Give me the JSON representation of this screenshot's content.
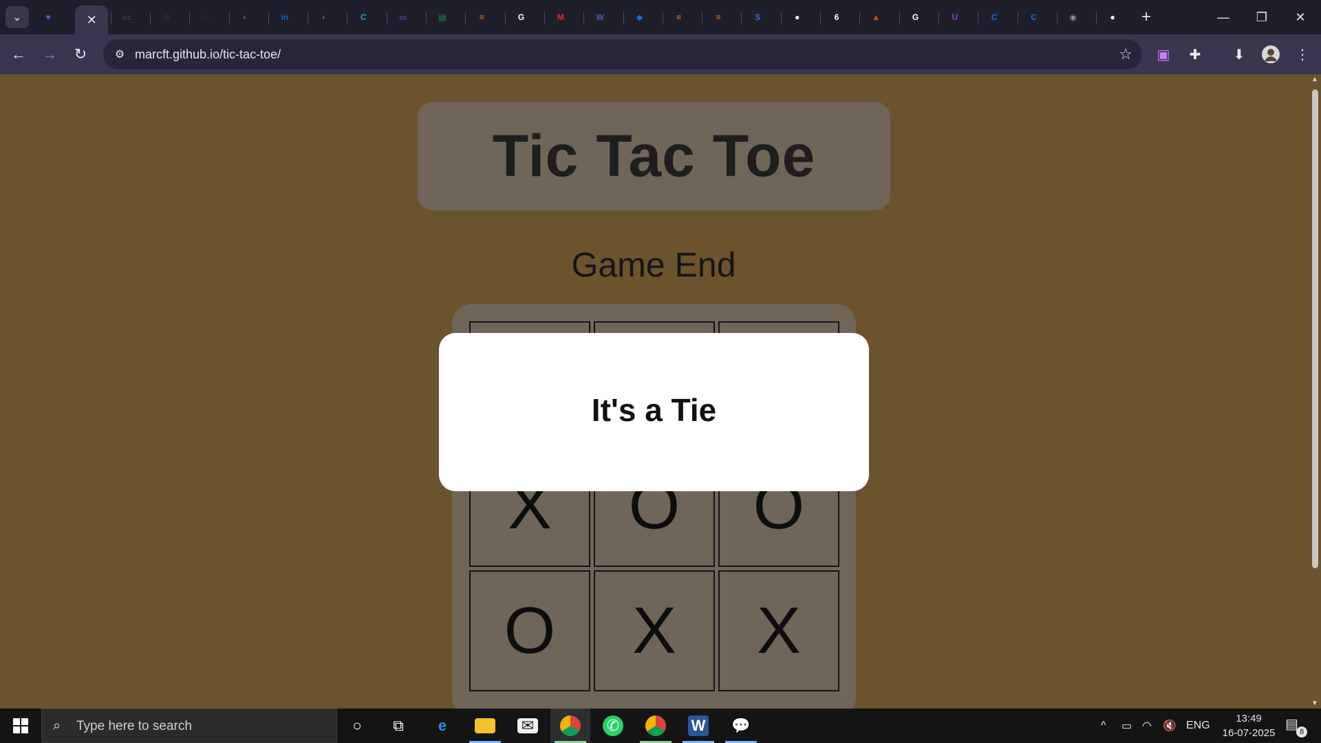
{
  "browser": {
    "url": "marcft.github.io/tic-tac-toe/",
    "tabs": [
      {
        "icon": "shield-heart-icon",
        "glyph": "♥",
        "color": "#3b6fd8"
      },
      {
        "icon": "close-icon",
        "glyph": "✕",
        "active": true
      },
      {
        "icon": "cc-icon",
        "glyph": "cc",
        "color": "#5a3a1a"
      },
      {
        "icon": "target-icon",
        "glyph": "◎",
        "color": "#3a3a3a"
      },
      {
        "icon": "logo-icon",
        "glyph": "≈",
        "color": "#2a2a2a"
      },
      {
        "icon": "globe-icon",
        "glyph": "◐",
        "color": "#5a5a6a"
      },
      {
        "icon": "linkedin-icon",
        "glyph": "in",
        "color": "#0a66c2"
      },
      {
        "icon": "globe-icon",
        "glyph": "◐",
        "color": "#5a5a6a"
      },
      {
        "icon": "c-circle-icon",
        "glyph": "C",
        "color": "#1ea0d8"
      },
      {
        "icon": "screen-icon",
        "glyph": "▭",
        "color": "#6a5ae0"
      },
      {
        "icon": "sheet-icon",
        "glyph": "▤",
        "color": "#1e8e3e"
      },
      {
        "icon": "stack-icon",
        "glyph": "≡",
        "color": "#e07a1a"
      },
      {
        "icon": "google-icon",
        "glyph": "G",
        "color": "#ffffff"
      },
      {
        "icon": "gmail-icon",
        "glyph": "M",
        "color": "#d93025"
      },
      {
        "icon": "w-icon",
        "glyph": "W",
        "color": "#4a5aa0"
      },
      {
        "icon": "bookmark-blue-icon",
        "glyph": "◆",
        "color": "#1a6ad8"
      },
      {
        "icon": "stack-icon",
        "glyph": "≡",
        "color": "#e07a1a"
      },
      {
        "icon": "stack-icon",
        "glyph": "≡",
        "color": "#e07a1a"
      },
      {
        "icon": "s-icon",
        "glyph": "S",
        "color": "#3a6ad8"
      },
      {
        "icon": "github-icon",
        "glyph": "●",
        "color": "#ffffff"
      },
      {
        "icon": "six-icon",
        "glyph": "6",
        "color": "#ffffff"
      },
      {
        "icon": "flame-icon",
        "glyph": "▲",
        "color": "#e04a1a"
      },
      {
        "icon": "google-icon",
        "glyph": "G",
        "color": "#ffffff"
      },
      {
        "icon": "u-icon",
        "glyph": "U",
        "color": "#8a3ad8"
      },
      {
        "icon": "c-blue-icon",
        "glyph": "C",
        "color": "#1a6ad8"
      },
      {
        "icon": "c-blue-icon",
        "glyph": "C",
        "color": "#1a6ad8"
      },
      {
        "icon": "chrome-icon",
        "glyph": "◉",
        "color": "#8a8a9a"
      },
      {
        "icon": "github-icon",
        "glyph": "●",
        "color": "#ffffff"
      }
    ]
  },
  "page": {
    "title": "Tic Tac Toe",
    "status": "Game End",
    "board": [
      "",
      "",
      "",
      "X",
      "O",
      "O",
      "O",
      "X",
      "X"
    ],
    "modal_message": "It's a Tie"
  },
  "taskbar": {
    "search_placeholder": "Type here to search",
    "language": "ENG",
    "time": "13:49",
    "date": "16-07-2025",
    "notification_count": "8"
  },
  "colors": {
    "page_bg": "#6b532d",
    "panel": "#6f6559",
    "chrome_dark": "#1f1e2b",
    "chrome_toolbar": "#3b3650"
  }
}
